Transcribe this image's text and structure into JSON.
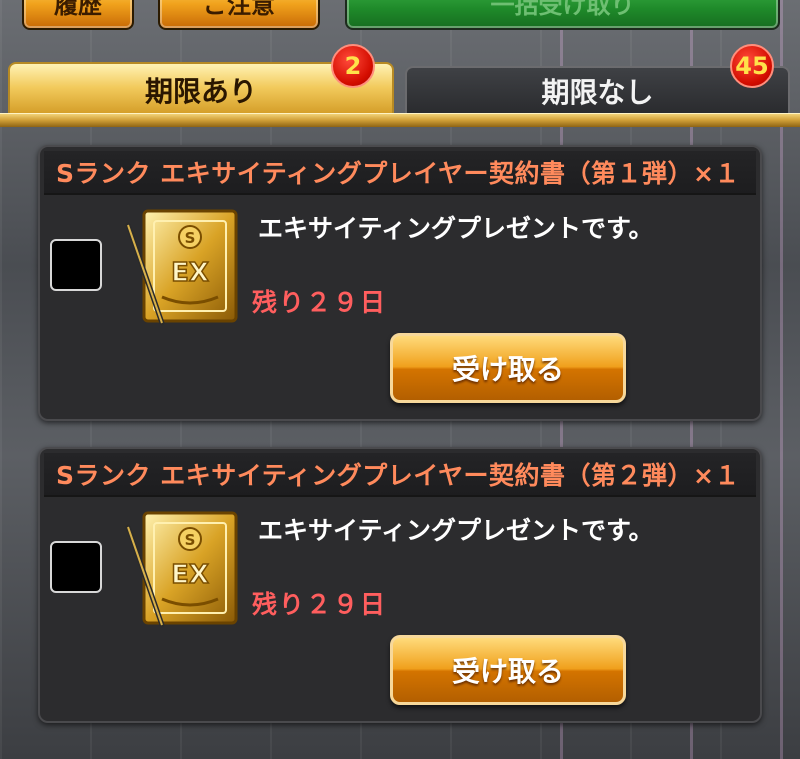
{
  "header": {
    "buttons": [
      {
        "label": "履歴"
      },
      {
        "label": "ご注意"
      },
      {
        "label": "一括受け取り"
      }
    ]
  },
  "tabs": [
    {
      "label": "期限あり",
      "badge": "2",
      "active": true
    },
    {
      "label": "期限なし",
      "badge": "45",
      "active": false
    }
  ],
  "items": [
    {
      "title": "Sランク エキサイティングプレイヤー契約書（第１弾）×１",
      "description": "エキサイティングプレゼントです。",
      "remaining": "残り２９日",
      "button_label": "受け取る",
      "icon": "ex-contract-icon"
    },
    {
      "title": "Sランク エキサイティングプレイヤー契約書（第２弾）×１",
      "description": "エキサイティングプレゼントです。",
      "remaining": "残り２９日",
      "button_label": "受け取る",
      "icon": "ex-contract-icon"
    }
  ],
  "colors": {
    "title_text": "#ff8a5c",
    "remaining_text": "#ff5e5e",
    "badge": "#d40d00",
    "accent_gold": "#f0a01c"
  }
}
